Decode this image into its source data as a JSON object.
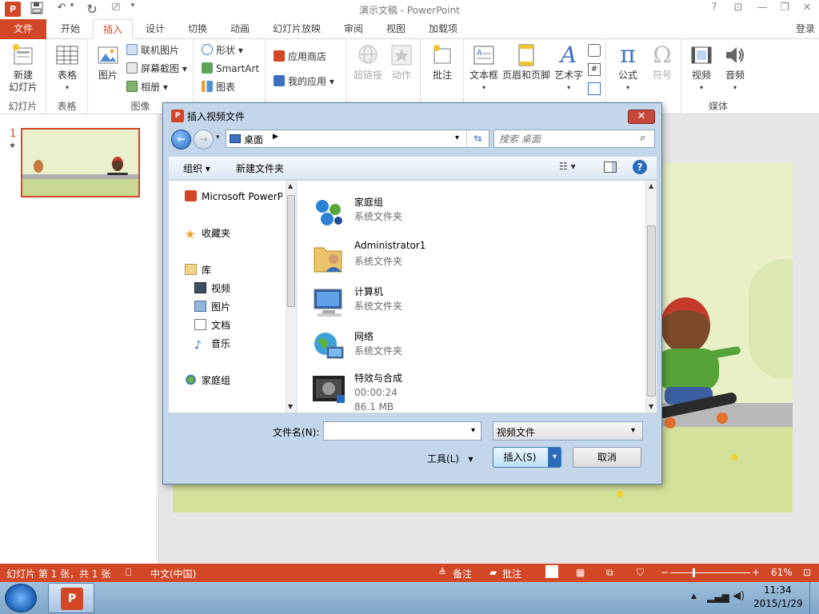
{
  "app": {
    "title": "演示文稿 - PowerPoint",
    "login": "登录",
    "help_button": "?"
  },
  "tabs": [
    "文件",
    "开始",
    "插入",
    "设计",
    "切换",
    "动画",
    "幻灯片放映",
    "审阅",
    "视图",
    "加载项"
  ],
  "ribbon": {
    "new_slide": "新建\n幻灯片",
    "table": "表格",
    "picture": "图片",
    "online_picture": "联机图片",
    "screenshot": "屏幕截图",
    "album": "相册",
    "shapes": "形状",
    "smartart": "SmartArt",
    "chart": "图表",
    "store": "应用商店",
    "my_apps": "我的应用",
    "hyperlink": "超链接",
    "action": "动作",
    "comment": "批注",
    "textbox": "文本框",
    "header_footer": "页眉和页脚",
    "wordart": "艺术字",
    "equation": "公式",
    "symbol": "符号",
    "video": "视频",
    "audio": "音频",
    "groups": {
      "slides": "幻灯片",
      "tables": "表格",
      "images": "图像",
      "media": "媒体"
    }
  },
  "slide_panel": {
    "number": "1",
    "star": "★"
  },
  "dialog": {
    "title": "插入视频文件",
    "address": "桌面",
    "search_placeholder": "搜索 桌面",
    "organize": "组织",
    "new_folder": "新建文件夹",
    "nav": {
      "top_item": "Microsoft PowerPoint",
      "favorites": "收藏夹",
      "libraries": "库",
      "videos": "视频",
      "pictures": "图片",
      "documents": "文档",
      "music": "音乐",
      "homegroup": "家庭组"
    },
    "files": [
      {
        "name": "家庭组",
        "type": "系统文件夹",
        "icon": "homegroup-icon"
      },
      {
        "name": "Administrator1",
        "type": "系统文件夹",
        "icon": "user-folder-icon"
      },
      {
        "name": "计算机",
        "type": "系统文件夹",
        "icon": "computer-icon"
      },
      {
        "name": "网络",
        "type": "系统文件夹",
        "icon": "network-icon"
      },
      {
        "name": "特效与合成",
        "duration": "00:00:24",
        "size": "86.1 MB",
        "icon": "video-file-icon"
      }
    ],
    "filename_label": "文件名(N):",
    "filename_value": "",
    "filetype": "视频文件",
    "tools": "工具(L)",
    "insert": "插入(S)",
    "cancel": "取消"
  },
  "status": {
    "slide_info": "幻灯片 第 1 张，共 1 张",
    "language": "中文(中国)",
    "notes": "备注",
    "comments": "批注",
    "zoom": "61%"
  },
  "taskbar": {
    "time": "11:34",
    "date": "2015/1/29"
  },
  "colors": {
    "accent": "#d24726",
    "dialog_frame": "#c3d6ea"
  }
}
